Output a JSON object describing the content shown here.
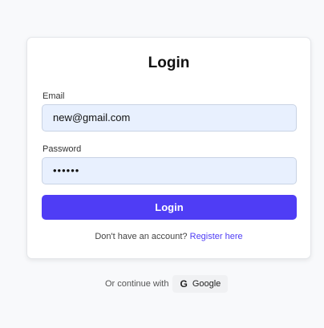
{
  "login": {
    "title": "Login",
    "email_label": "Email",
    "email_value": "new@gmail.com",
    "password_label": "Password",
    "password_value": "••••••",
    "submit_label": "Login",
    "register_prompt": "Don't have an account?",
    "register_link": "Register here"
  },
  "alt_login": {
    "continue_text": "Or continue with",
    "google_icon": "google-g-icon",
    "google_label": "Google"
  },
  "colors": {
    "accent": "#4f3df5",
    "input_bg": "#e8f0fe",
    "page_bg": "#f8f9fb"
  }
}
